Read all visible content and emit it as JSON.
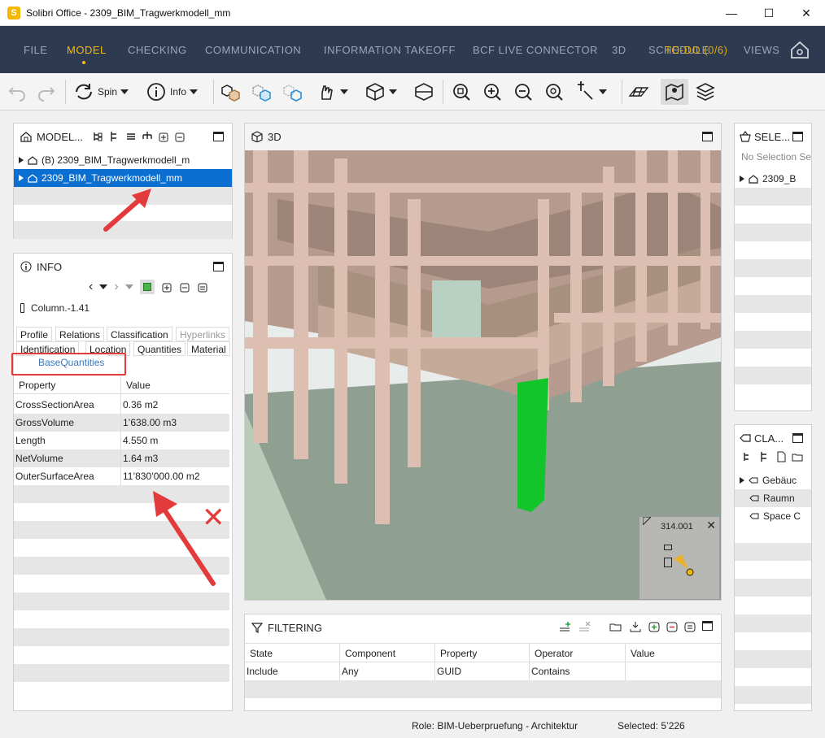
{
  "window": {
    "title": "Solibri Office - 2309_BIM_Tragwerkmodell_mm",
    "app_icon_letter": "S",
    "minimize": "—",
    "maximize": "☐",
    "close": "✕"
  },
  "menu": {
    "items": [
      "FILE",
      "MODEL",
      "CHECKING",
      "COMMUNICATION",
      "INFORMATION TAKEOFF",
      "BCF LIVE CONNECTOR",
      "3D",
      "SCHEDULE"
    ],
    "active": "MODEL",
    "todo": "TO-DO (0/6)",
    "views": "VIEWS"
  },
  "toolbar": {
    "spin_label": "Spin",
    "info_label": "Info"
  },
  "model_panel": {
    "title": "MODEL...",
    "rows": [
      "(B) 2309_BIM_Tragwerkmodell_m",
      "2309_BIM_Tragwerkmodell_mm"
    ]
  },
  "info_panel": {
    "title": "INFO",
    "element": "Column.-1.41",
    "tabs_row1": [
      "Profile",
      "Relations",
      "Classification",
      "Hyperlinks"
    ],
    "tabs_row2": [
      "Identification",
      "Location",
      "Quantities",
      "Material"
    ],
    "tab_active": "BaseQuantities",
    "columns": [
      "Property",
      "Value"
    ],
    "rows": [
      {
        "property": "CrossSectionArea",
        "value": "0.36 m2"
      },
      {
        "property": "GrossVolume",
        "value": "1’638.00 m3"
      },
      {
        "property": "Length",
        "value": "4.550 m"
      },
      {
        "property": "NetVolume",
        "value": "1.64 m3"
      },
      {
        "property": "OuterSurfaceArea",
        "value": "11’830’000.00 m2"
      }
    ]
  },
  "viewport": {
    "title": "3D",
    "minimap_label": "314.001",
    "minimap_close": "✕"
  },
  "selection_panel": {
    "title": "SELE...",
    "placeholder": "No Selection Se",
    "row": "2309_B"
  },
  "class_panel": {
    "title": "CLA...",
    "rows": [
      "Gebäuc",
      "Raumn",
      "Space C"
    ]
  },
  "filtering": {
    "title": "FILTERING",
    "columns": [
      "State",
      "Component",
      "Property",
      "Operator",
      "Value"
    ],
    "row": [
      "Include",
      "Any",
      "GUID",
      "Contains",
      ""
    ]
  },
  "status": {
    "role": "Role: BIM-Ueberpruefung - Architektur",
    "selected": "Selected: 5’226"
  },
  "annotation_color": "#e33b3b",
  "selection_color": "#0a6fd1",
  "accent_color": "#f5b800"
}
